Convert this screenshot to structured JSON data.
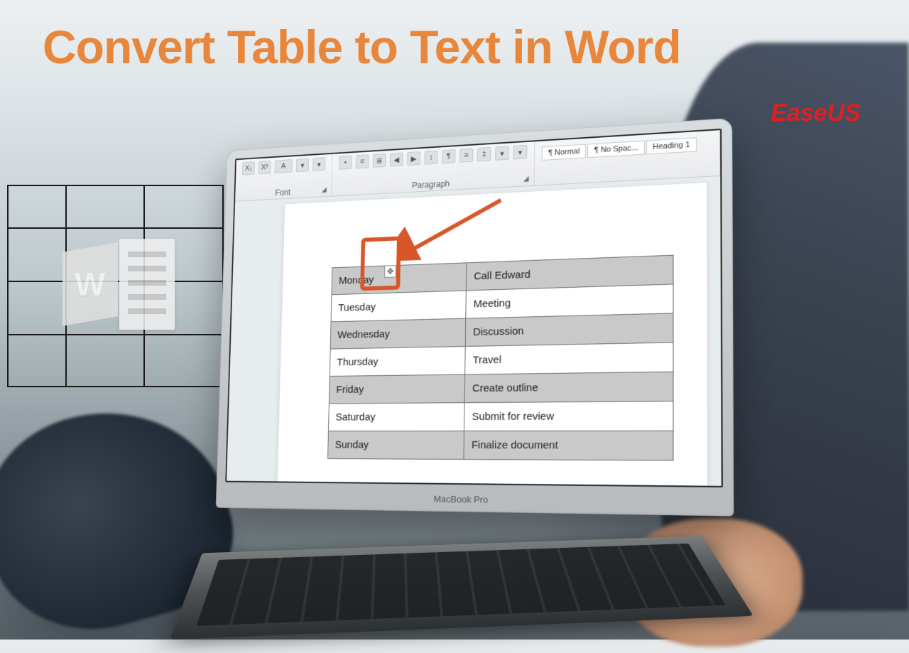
{
  "headline": "Convert Table to Text in Word",
  "brand": "EaseUS",
  "laptop_model": "MacBook Pro",
  "word_icon_letter": "W",
  "ribbon": {
    "font_group": "Font",
    "paragraph_group": "Paragraph",
    "font_btn_x2": "X₂",
    "font_btn_X2": "X²",
    "font_btn_A": "A",
    "styles": {
      "normal": "¶ Normal",
      "nospacing": "¶ No Spac...",
      "heading1": "Heading 1"
    }
  },
  "move_handle_glyph": "✥",
  "table": {
    "rows": [
      {
        "day": "Monday",
        "task": "Call Edward"
      },
      {
        "day": "Tuesday",
        "task": "Meeting"
      },
      {
        "day": "Wednesday",
        "task": "Discussion"
      },
      {
        "day": "Thursday",
        "task": "Travel"
      },
      {
        "day": "Friday",
        "task": "Create outline"
      },
      {
        "day": "Saturday",
        "task": "Submit for review"
      },
      {
        "day": "Sunday",
        "task": "Finalize document"
      }
    ]
  }
}
